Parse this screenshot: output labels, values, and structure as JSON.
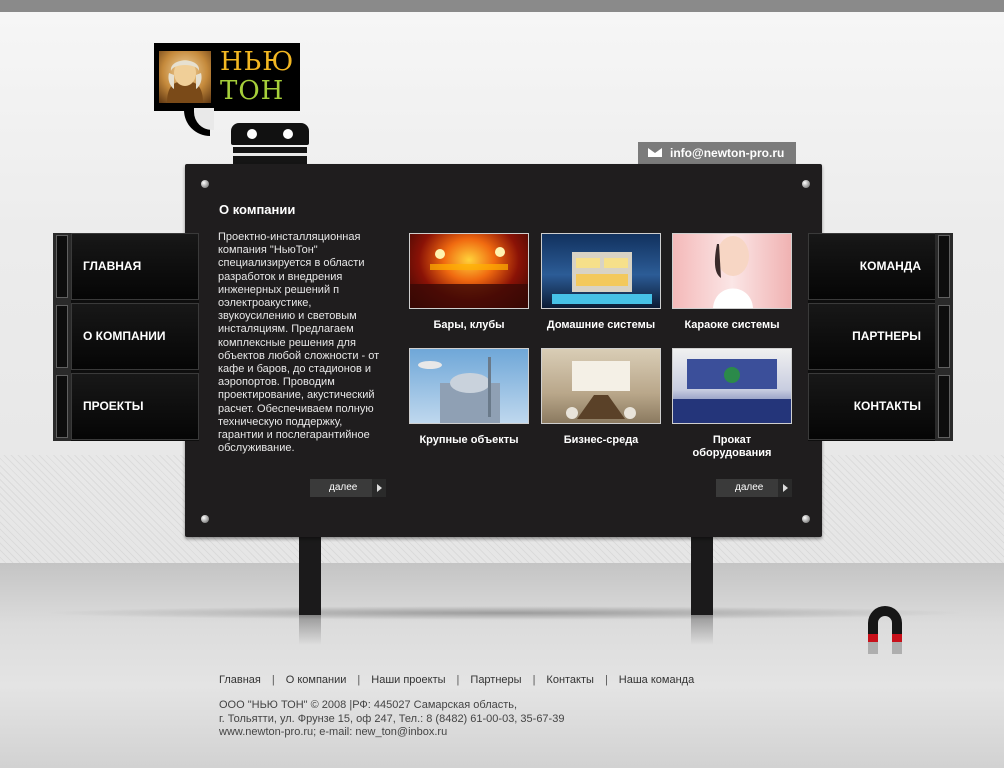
{
  "header": {
    "logo_line1": "НЬЮ",
    "logo_line2": "ТОН",
    "email": "info@newton-pro.ru"
  },
  "left_menu": [
    {
      "label": "ГЛАВНАЯ"
    },
    {
      "label": "О КОМПАНИИ"
    },
    {
      "label": "ПРОЕКТЫ"
    }
  ],
  "right_menu": [
    {
      "label": "КОМАНДА"
    },
    {
      "label": "ПАРТНЕРЫ"
    },
    {
      "label": "КОНТАКТЫ"
    }
  ],
  "about": {
    "title": "О компании",
    "text": "Проектно-инсталляционная компания \"НьюТон\" специализируется в области разработок и внедрения инженерных решений п оэлектроакустике, звукоусилению и световым инсталяциям. Предлагаем комплексные решения для объектов любой сложности - от кафе и баров, до стадионов и аэропортов. Проводим проектирование, акустический расчет. Обеспечиваем полную техническую поддержку, гарантии и послегарантийное обслуживание.",
    "more_label": "далее"
  },
  "categories": [
    {
      "label": "Бары, клубы",
      "icon": "club-stage-photo"
    },
    {
      "label": "Домашние системы",
      "icon": "modern-house-photo"
    },
    {
      "label": "Караоке системы",
      "icon": "karaoke-singer-photo"
    },
    {
      "label": "Крупные объекты",
      "icon": "large-building-photo"
    },
    {
      "label": "Бизнес-среда",
      "icon": "conference-room-photo"
    },
    {
      "label": "Прокат оборудования",
      "icon": "auditorium-photo"
    }
  ],
  "categories_more_label": "далее",
  "footer": {
    "nav": [
      "Главная",
      "О компании",
      "Наши проекты",
      "Партнеры",
      "Контакты",
      "Наша команда"
    ],
    "separator": "|",
    "line1": "ООО \"НЬЮ ТОН\" © 2008 |РФ: 445027 Самарская область,",
    "line2": "г. Тольятти, ул. Фрунзе 15, оф 247, Тел.: 8 (8482) 61-00-03, 35-67-39",
    "line3": "www.newton-pro.ru; e-mail: new_ton@inbox.ru"
  },
  "colors": {
    "board": "#1f1d1e",
    "logo_line1": "#f2b722",
    "logo_line2": "#a6cf3a",
    "magnet_red": "#c8101a"
  }
}
